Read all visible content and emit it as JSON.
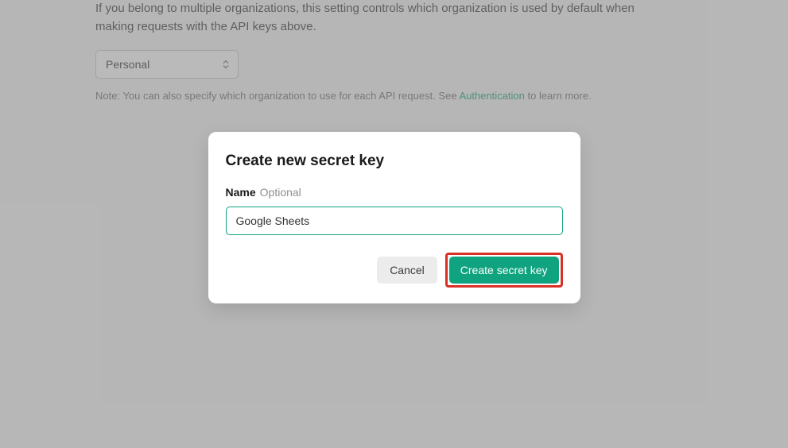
{
  "page": {
    "description": "If you belong to multiple organizations, this setting controls which organization is used by default when making requests with the API keys above.",
    "org_select": {
      "value": "Personal"
    },
    "note_prefix": "Note: You can also specify which organization to use for each API request. See ",
    "note_link": "Authentication",
    "note_suffix": " to learn more."
  },
  "modal": {
    "title": "Create new secret key",
    "name_label": "Name",
    "name_optional": "Optional",
    "name_input": {
      "value": "Google Sheets"
    },
    "cancel_label": "Cancel",
    "create_label": "Create secret key"
  }
}
